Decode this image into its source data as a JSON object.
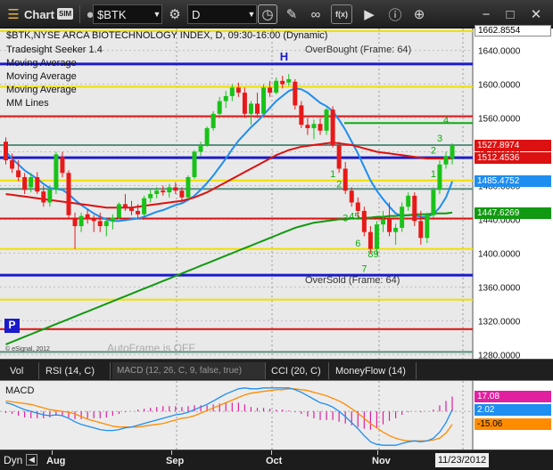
{
  "toolbar": {
    "app_name": "Chart",
    "app_badge": "SIM",
    "symbol": "$BTK",
    "interval": "D"
  },
  "chart": {
    "title": "$BTK,NYSE ARCA BIOTECHNOLOGY INDEX, D, 09:30-16:00 (Dynamic)",
    "studies": [
      "Tradesight Seeker 1.4",
      "Moving Average",
      "Moving Average",
      "Moving Average",
      "MM Lines"
    ],
    "overbought_label": "OverBought (Frame: 64)",
    "oversold_label": "OverSold (Frame: 64)",
    "overbought_marker": "H",
    "autoframe_label": "AutoFrame is OFF",
    "copyright": "© eSignal, 2012",
    "p_marker": "P",
    "colors": {
      "up": "#19c219",
      "down": "#e81919",
      "ma_blue": "#1e8ef0",
      "ma_red": "#dd1111",
      "ma_green": "#119911"
    }
  },
  "chart_data": [
    {
      "type": "candlestick",
      "title": "$BTK,NYSE ARCA BIOTECHNOLOGY INDEX, D, 09:30-16:00 (Dynamic)",
      "x_labels": [
        "Aug",
        "Sep",
        "Oct",
        "Nov"
      ],
      "y_ticks": [
        "1640.0000",
        "1600.0000",
        "1560.0000",
        "1520.0000",
        "1480.0000",
        "1440.0000",
        "1400.0000",
        "1360.0000",
        "1320.0000",
        "1280.0000"
      ],
      "ylim": [
        1275,
        1666
      ],
      "price_labels": [
        {
          "text": "1662.8554",
          "value": 1662.8554,
          "color": "#ffffff",
          "text_color": "#000000"
        },
        {
          "text": "1527.8974",
          "value": 1527.8974,
          "color": "#dd1111",
          "text_color": "#ffffff"
        },
        {
          "text": "1512.4536",
          "value": 1512.4536,
          "color": "#dd1111",
          "text_color": "#ffffff"
        },
        {
          "text": "1485.4752",
          "value": 1485.4752,
          "color": "#1e8ef0",
          "text_color": "#ffffff"
        },
        {
          "text": "1447.6269",
          "value": 1447.6269,
          "color": "#119911",
          "text_color": "#ffffff"
        }
      ],
      "levels": [
        {
          "value": 1662.86,
          "color": "#f0e000"
        },
        {
          "value": 1624,
          "color": "#1a1acc"
        },
        {
          "value": 1597,
          "color": "#f0e000"
        },
        {
          "value": 1562,
          "color": "#dd1111"
        },
        {
          "value": 1528,
          "color": "#5a8f80"
        },
        {
          "value": 1513,
          "color": "#1a1acc"
        },
        {
          "value": 1486,
          "color": "#f0e000"
        },
        {
          "value": 1476,
          "color": "#5a8f80"
        },
        {
          "value": 1441,
          "color": "#dd1111"
        },
        {
          "value": 1405,
          "color": "#f0e000"
        },
        {
          "value": 1374,
          "color": "#1a1acc"
        },
        {
          "value": 1345,
          "color": "#f0e000"
        },
        {
          "value": 1310,
          "color": "#dd1111"
        },
        {
          "value": 1283,
          "color": "#5a8f80"
        }
      ],
      "candles": [
        [
          1532,
          1537,
          1505,
          1510
        ],
        [
          1510,
          1518,
          1495,
          1500
        ],
        [
          1498,
          1510,
          1485,
          1490
        ],
        [
          1490,
          1495,
          1470,
          1475
        ],
        [
          1478,
          1495,
          1472,
          1490
        ],
        [
          1490,
          1496,
          1470,
          1473
        ],
        [
          1473,
          1480,
          1455,
          1460
        ],
        [
          1460,
          1480,
          1455,
          1476
        ],
        [
          1476,
          1520,
          1470,
          1517
        ],
        [
          1514,
          1520,
          1490,
          1495
        ],
        [
          1495,
          1498,
          1440,
          1445
        ],
        [
          1440,
          1448,
          1405,
          1432
        ],
        [
          1432,
          1448,
          1425,
          1444
        ],
        [
          1446,
          1452,
          1435,
          1440
        ],
        [
          1440,
          1445,
          1425,
          1438
        ],
        [
          1438,
          1448,
          1425,
          1432
        ],
        [
          1432,
          1440,
          1420,
          1438
        ],
        [
          1438,
          1446,
          1428,
          1442
        ],
        [
          1442,
          1460,
          1440,
          1458
        ],
        [
          1458,
          1470,
          1450,
          1453
        ],
        [
          1453,
          1462,
          1445,
          1450
        ],
        [
          1450,
          1458,
          1440,
          1446
        ],
        [
          1446,
          1468,
          1444,
          1465
        ],
        [
          1465,
          1475,
          1460,
          1470
        ],
        [
          1470,
          1478,
          1465,
          1474
        ],
        [
          1474,
          1480,
          1468,
          1472
        ],
        [
          1472,
          1482,
          1466,
          1478
        ],
        [
          1478,
          1484,
          1470,
          1474
        ],
        [
          1474,
          1478,
          1460,
          1466
        ],
        [
          1466,
          1492,
          1464,
          1490
        ],
        [
          1490,
          1522,
          1488,
          1520
        ],
        [
          1520,
          1532,
          1515,
          1528
        ],
        [
          1528,
          1550,
          1526,
          1548
        ],
        [
          1548,
          1568,
          1545,
          1565
        ],
        [
          1565,
          1585,
          1560,
          1580
        ],
        [
          1580,
          1592,
          1572,
          1586
        ],
        [
          1586,
          1600,
          1580,
          1596
        ],
        [
          1596,
          1602,
          1585,
          1590
        ],
        [
          1590,
          1596,
          1560,
          1565
        ],
        [
          1565,
          1580,
          1552,
          1577
        ],
        [
          1577,
          1590,
          1560,
          1565
        ],
        [
          1565,
          1600,
          1562,
          1596
        ],
        [
          1596,
          1604,
          1585,
          1590
        ],
        [
          1590,
          1608,
          1588,
          1604
        ],
        [
          1604,
          1610,
          1595,
          1600
        ],
        [
          1602,
          1612,
          1598,
          1606
        ],
        [
          1603,
          1606,
          1570,
          1575
        ],
        [
          1575,
          1580,
          1548,
          1552
        ],
        [
          1552,
          1560,
          1540,
          1548
        ],
        [
          1548,
          1558,
          1535,
          1553
        ],
        [
          1553,
          1560,
          1540,
          1545
        ],
        [
          1545,
          1572,
          1540,
          1570
        ],
        [
          1570,
          1574,
          1525,
          1528
        ],
        [
          1528,
          1532,
          1495,
          1500
        ],
        [
          1500,
          1508,
          1470,
          1474
        ],
        [
          1474,
          1478,
          1455,
          1460
        ],
        [
          1460,
          1466,
          1440,
          1450
        ],
        [
          1450,
          1455,
          1420,
          1425
        ],
        [
          1425,
          1432,
          1400,
          1405
        ],
        [
          1405,
          1438,
          1398,
          1434
        ],
        [
          1434,
          1450,
          1425,
          1440
        ],
        [
          1440,
          1460,
          1420,
          1425
        ],
        [
          1425,
          1435,
          1410,
          1430
        ],
        [
          1430,
          1460,
          1425,
          1455
        ],
        [
          1455,
          1472,
          1450,
          1468
        ],
        [
          1468,
          1472,
          1432,
          1438
        ],
        [
          1438,
          1450,
          1410,
          1418
        ],
        [
          1418,
          1448,
          1412,
          1445
        ],
        [
          1445,
          1478,
          1442,
          1475
        ],
        [
          1475,
          1510,
          1470,
          1505
        ],
        [
          1505,
          1520,
          1500,
          1515
        ],
        [
          1512,
          1530,
          1505,
          1528
        ]
      ],
      "moving_averages": [
        {
          "color": "#1e8ef0",
          "values": [
            1520,
            1512,
            1505,
            1498,
            1493,
            1488,
            1482,
            1477,
            1476,
            1475,
            1470,
            1463,
            1457,
            1452,
            1447,
            1443,
            1440,
            1438,
            1438,
            1439,
            1440,
            1441,
            1443,
            1446,
            1449,
            1451,
            1454,
            1457,
            1459,
            1463,
            1468,
            1475,
            1483,
            1492,
            1502,
            1512,
            1523,
            1533,
            1541,
            1549,
            1556,
            1564,
            1572,
            1580,
            1586,
            1592,
            1595,
            1594,
            1590,
            1584,
            1578,
            1574,
            1568,
            1558,
            1546,
            1532,
            1518,
            1502,
            1486,
            1474,
            1464,
            1455,
            1447,
            1444,
            1445,
            1445,
            1443,
            1443,
            1446,
            1454,
            1466,
            1485
          ]
        },
        {
          "color": "#dd1111",
          "values": [
            1470,
            1469,
            1468,
            1467,
            1466,
            1465,
            1464,
            1463,
            1462,
            1461,
            1460,
            1459,
            1458,
            1457,
            1456,
            1455,
            1454,
            1454,
            1454,
            1454,
            1454,
            1455,
            1456,
            1457,
            1458,
            1459,
            1460,
            1461,
            1462,
            1464,
            1466,
            1469,
            1472,
            1476,
            1480,
            1484,
            1488,
            1492,
            1496,
            1500,
            1504,
            1508,
            1512,
            1516,
            1519,
            1522,
            1524,
            1526,
            1527,
            1528,
            1529,
            1530,
            1531,
            1530,
            1529,
            1528,
            1526,
            1524,
            1522,
            1520,
            1519,
            1518,
            1517,
            1516,
            1515,
            1514,
            1513,
            1512,
            1512,
            1512,
            1512,
            1512
          ]
        },
        {
          "color": "#119911",
          "values": [
            1292,
            1295,
            1298,
            1301,
            1304,
            1307,
            1310,
            1313,
            1316,
            1319,
            1322,
            1325,
            1328,
            1331,
            1334,
            1337,
            1340,
            1343,
            1346,
            1349,
            1352,
            1355,
            1358,
            1361,
            1364,
            1367,
            1370,
            1373,
            1376,
            1379,
            1382,
            1385,
            1388,
            1391,
            1394,
            1397,
            1400,
            1403,
            1406,
            1409,
            1412,
            1415,
            1418,
            1421,
            1424,
            1427,
            1430,
            1432,
            1434,
            1436,
            1437,
            1438,
            1439,
            1440,
            1440,
            1441,
            1441,
            1442,
            1442,
            1443,
            1443,
            1444,
            1444,
            1445,
            1445,
            1446,
            1446,
            1446,
            1447,
            1447,
            1447,
            1448
          ]
        }
      ],
      "seeker_counts": [
        {
          "text": "H",
          "index": 44,
          "value": 1628
        },
        {
          "text": "4",
          "index": 70,
          "value": 1554
        },
        {
          "text": "3",
          "index": 69,
          "value": 1532
        },
        {
          "text": "2",
          "index": 68,
          "value": 1518
        },
        {
          "text": "1",
          "index": 68,
          "value": 1490
        },
        {
          "text": "1",
          "index": 52,
          "value": 1490
        },
        {
          "text": "2",
          "index": 53,
          "value": 1478
        },
        {
          "text": "3",
          "index": 54,
          "value": 1438
        },
        {
          "text": "45",
          "index": 55,
          "value": 1440
        },
        {
          "text": "6",
          "index": 56,
          "value": 1408
        },
        {
          "text": "89",
          "index": 58,
          "value": 1395
        },
        {
          "text": "7",
          "index": 57,
          "value": 1378
        }
      ]
    },
    {
      "type": "line",
      "title": "MACD",
      "parameters": "MACD (12, 26, C, 9, false, true)",
      "ylim": [
        -45,
        35
      ],
      "value_labels": [
        {
          "text": "17.08",
          "value": 17.08,
          "color": "#e0209e"
        },
        {
          "text": "2.02",
          "value": 2.02,
          "color": "#1e8ef0"
        },
        {
          "text": "-15.06",
          "value": -15.06,
          "color": "#ff8c00"
        }
      ],
      "series": [
        {
          "color": "#1e8ef0",
          "values": [
            10,
            8,
            5,
            2,
            0,
            -2,
            -4,
            -5,
            -4,
            -5,
            -8,
            -12,
            -15,
            -17,
            -19,
            -21,
            -22,
            -22,
            -21,
            -19,
            -18,
            -16,
            -14,
            -12,
            -10,
            -8,
            -6,
            -4,
            -3,
            -1,
            2,
            5,
            8,
            12,
            16,
            20,
            23,
            26,
            27,
            26,
            26,
            27,
            27,
            27,
            27,
            27,
            25,
            22,
            18,
            14,
            10,
            8,
            5,
            0,
            -6,
            -13,
            -20,
            -28,
            -35,
            -38,
            -39,
            -39,
            -39,
            -37,
            -35,
            -34,
            -35,
            -34,
            -31,
            -24,
            -13,
            2
          ]
        },
        {
          "color": "#ff8c00",
          "values": [
            12,
            11,
            10,
            9,
            8,
            6,
            4,
            2,
            1,
            0,
            -1,
            -3,
            -6,
            -9,
            -11,
            -13,
            -15,
            -17,
            -18,
            -18,
            -18,
            -18,
            -17,
            -16,
            -15,
            -14,
            -12,
            -10,
            -8,
            -7,
            -5,
            -2,
            1,
            4,
            7,
            10,
            13,
            16,
            19,
            21,
            22,
            23,
            24,
            25,
            25,
            26,
            26,
            25,
            24,
            22,
            20,
            18,
            15,
            12,
            8,
            3,
            -2,
            -8,
            -14,
            -19,
            -24,
            -28,
            -31,
            -33,
            -34,
            -34,
            -34,
            -34,
            -33,
            -31,
            -25,
            -15
          ]
        },
        {
          "color": "#e0209e",
          "values": [
            -2,
            -3,
            -5,
            -7,
            -8,
            -8,
            -8,
            -7,
            -5,
            -5,
            -7,
            -9,
            -9,
            -8,
            -8,
            -8,
            -7,
            -5,
            -3,
            -1,
            0,
            2,
            3,
            4,
            5,
            6,
            6,
            6,
            5,
            6,
            7,
            7,
            7,
            8,
            9,
            10,
            10,
            10,
            8,
            5,
            4,
            4,
            3,
            2,
            2,
            1,
            -1,
            -3,
            -6,
            -8,
            -10,
            -10,
            -10,
            -12,
            -14,
            -16,
            -18,
            -20,
            -21,
            -19,
            -15,
            -11,
            -8,
            -4,
            -1,
            0,
            -1,
            0,
            2,
            7,
            12,
            17
          ]
        }
      ]
    }
  ],
  "indicator_tabs": [
    "Vol",
    "RSI (14, C)",
    "MACD (12, 26, C, 9, false, true)",
    "CCI (20, C)",
    "MoneyFlow (14)"
  ],
  "bottom_bar": {
    "interval_label": "Dyn",
    "date_label": "11/23/2012",
    "months": [
      "Aug",
      "Sep",
      "Oct",
      "Nov"
    ]
  }
}
